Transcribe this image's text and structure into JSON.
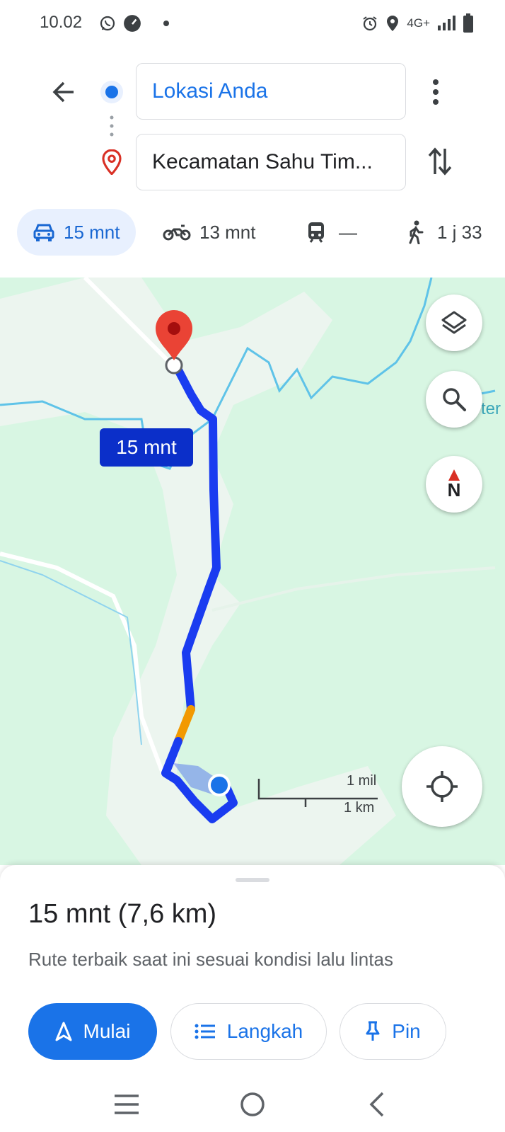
{
  "status_bar": {
    "time": "10.02",
    "icons": [
      "whatsapp-icon",
      "speedometer-icon",
      "dot-icon",
      "alarm-icon",
      "location-icon",
      "network-4g-icon",
      "signal-icon",
      "battery-icon"
    ],
    "network_label": "4G+"
  },
  "directions": {
    "origin": "Lokasi Anda",
    "destination": "Kecamatan Sahu Tim..."
  },
  "travel_modes": [
    {
      "mode": "car",
      "label": "15 mnt",
      "selected": true
    },
    {
      "mode": "motorcycle",
      "label": "13 mnt",
      "selected": false
    },
    {
      "mode": "transit",
      "label": "—",
      "selected": false
    },
    {
      "mode": "walk",
      "label": "1 j 33",
      "selected": false
    }
  ],
  "map": {
    "eta_label": "15 mnt",
    "edge_label": "ter",
    "compass_label": "N",
    "scale_mi": "1 mil",
    "scale_km": "1 km",
    "colors": {
      "route": "#1a3cf0",
      "route_slow": "#f29900",
      "water": "#5fc3e8",
      "land": "#d8f6e3",
      "pin": "#ea4335"
    }
  },
  "summary": {
    "title": "15 mnt (7,6 km)",
    "subtitle": "Rute terbaik saat ini sesuai kondisi lalu lintas"
  },
  "actions": {
    "start": "Mulai",
    "steps": "Langkah",
    "pin": "Pin"
  },
  "colors": {
    "accent": "#1a73e8",
    "selected_chip": "#e8f0fe"
  }
}
